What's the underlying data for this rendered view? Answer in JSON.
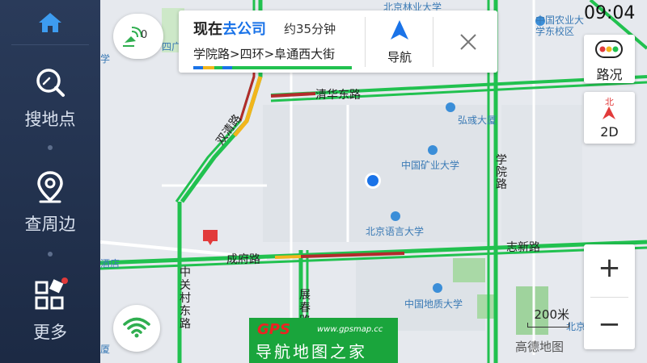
{
  "sidebar": {
    "items": [
      {
        "label": "搜地点",
        "icon": "search-icon"
      },
      {
        "label": "查周边",
        "icon": "location-pin-icon"
      },
      {
        "label": "更多",
        "icon": "more-grid-icon"
      }
    ]
  },
  "route_card": {
    "title_prefix": "现在",
    "destination": "去公司",
    "eta": "约35分钟",
    "via": "学院路>四环>阜通西大街",
    "navigate_label": "导航"
  },
  "gps_signal": {
    "count": "0"
  },
  "clock": "09:04",
  "right_controls": {
    "traffic_label": "路况",
    "view_mode_label": "2D",
    "compass_label": "北",
    "zoom_in": "+",
    "zoom_out": "−"
  },
  "scale": {
    "text": "200米"
  },
  "brand": "高德地图",
  "watermark": {
    "gps": "GPS",
    "url": "www.gpsmap.cc",
    "title": "导航地图之家"
  },
  "map_labels": {
    "pois": [
      {
        "name": "北京林业大学"
      },
      {
        "name": "中国农业大学东校区"
      },
      {
        "name": "弘彧大厦"
      },
      {
        "name": "中国矿业大学"
      },
      {
        "name": "北京语言大学"
      },
      {
        "name": "中国地质大学"
      },
      {
        "name": "四广场"
      },
      {
        "name": "学"
      },
      {
        "name": "酒店"
      },
      {
        "name": "北京"
      },
      {
        "name": "厦"
      }
    ],
    "roads": [
      {
        "name": "清华东路"
      },
      {
        "name": "双清路"
      },
      {
        "name": "学院路"
      },
      {
        "name": "成府路"
      },
      {
        "name": "志新路"
      },
      {
        "name": "中关村东路"
      },
      {
        "name": "展春路"
      }
    ]
  },
  "colors": {
    "road_green": "#21c14f",
    "road_red": "#b32b2b",
    "road_yellow": "#f2b51c",
    "accent_blue": "#1a73e8",
    "sidebar_bg": "#22324f"
  }
}
